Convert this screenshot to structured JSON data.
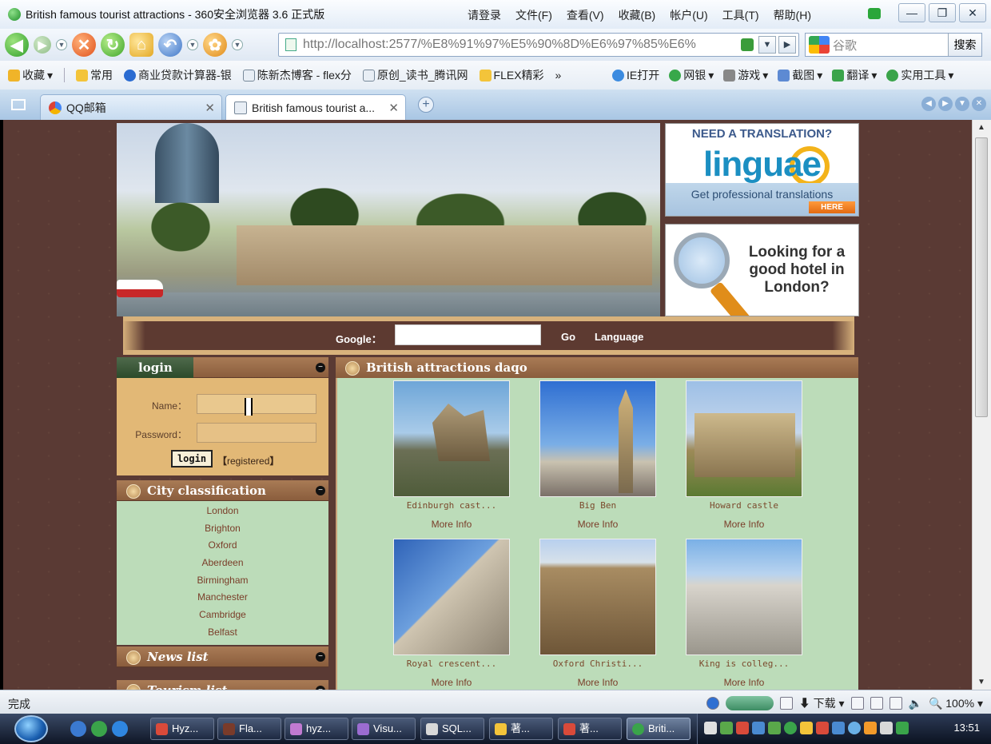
{
  "window": {
    "title": "British famous tourist attractions - 360安全浏览器 3.6 正式版",
    "login_link": "请登录",
    "menus": [
      "文件(F)",
      "查看(V)",
      "收藏(B)",
      "帐户(U)",
      "工具(T)",
      "帮助(H)"
    ],
    "controls": [
      "—",
      "❐",
      "✕"
    ]
  },
  "nav": {
    "address": "http://localhost:2577/%E8%91%97%E5%90%8D%E6%97%85%E6%",
    "search_placeholder": "谷歌",
    "search_button": "搜索"
  },
  "favorites": {
    "items": [
      "收藏",
      "常用",
      "商业贷款计算器-银",
      "陈新杰博客 - flex分",
      "原创_读书_腾讯网",
      "FLEX精彩",
      "»"
    ],
    "right_items": [
      "IE打开",
      "网银",
      "游戏",
      "截图",
      "翻译",
      "实用工具"
    ]
  },
  "tabs": [
    {
      "label": "QQ邮箱"
    },
    {
      "label": "British famous tourist a..."
    }
  ],
  "site": {
    "ad1": {
      "question": "NEED A TRANSLATION?",
      "brand": "linguae",
      "tagline": "Get professional translations",
      "cta": "HERE"
    },
    "ad2": {
      "text": "Looking for a good hotel in London?"
    },
    "search": {
      "label": "Google：",
      "go": "Go",
      "language": "Language"
    },
    "login": {
      "title": "login",
      "name_label": "Name：",
      "password_label": "Password：",
      "login_button": "login",
      "register_link": "registered"
    },
    "city": {
      "title": "City classification",
      "items": [
        "London",
        "Brighton",
        "Oxford",
        "Aberdeen",
        "Birmingham",
        "Manchester",
        "Cambridge",
        "Belfast"
      ]
    },
    "news_title": "News list",
    "tourism_title": "Tourism list",
    "attractions": {
      "title": "British attractions daqo",
      "more_label": "More Info",
      "cards": [
        {
          "name": "Edinburgh cast..."
        },
        {
          "name": "Big Ben"
        },
        {
          "name": "Howard castle"
        },
        {
          "name": "Royal crescent..."
        },
        {
          "name": "Oxford Christi..."
        },
        {
          "name": "King is colleg..."
        }
      ]
    }
  },
  "status": {
    "text": "完成",
    "download": "下载",
    "zoom": "100%"
  },
  "taskbar": {
    "items": [
      "Hyz...",
      "Fla...",
      "hyz...",
      "Visu...",
      "SQL...",
      "著...",
      "著...",
      "Briti..."
    ],
    "clock": "13:51"
  }
}
